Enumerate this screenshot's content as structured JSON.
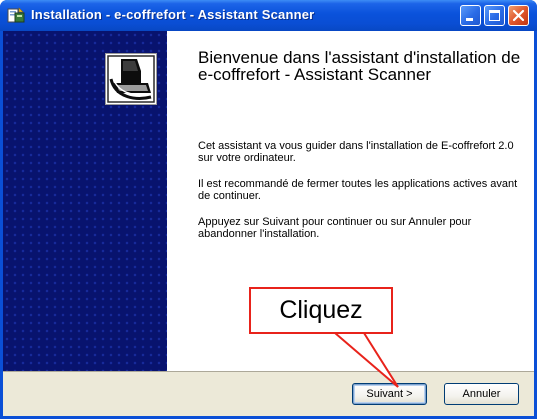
{
  "window": {
    "title": "Installation - e-coffrefort - Assistant Scanner",
    "icon": "installer-icon",
    "controls": {
      "minimize": "minimize-icon",
      "maximize": "maximize-icon",
      "close": "close-icon"
    }
  },
  "sidepanel": {
    "logo": "scanner-icon"
  },
  "content": {
    "heading": "Bienvenue dans l'assistant d'installation de e-coffrefort - Assistant Scanner",
    "paragraphs": [
      "Cet assistant va vous guider dans l'installation de E-coffrefort 2.0 sur votre ordinateur.",
      "Il est recommandé de fermer toutes les applications actives avant de continuer.",
      "Appuyez sur Suivant pour continuer ou sur Annuler pour abandonner l'installation."
    ]
  },
  "buttons": {
    "next": "Suivant >",
    "cancel": "Annuler"
  },
  "callout": {
    "text": "Cliquez",
    "color": "#e8231b"
  },
  "colors": {
    "titlebar": "#0a52db",
    "sidepanel": "#08136e",
    "button_bar": "#ece9d8"
  }
}
